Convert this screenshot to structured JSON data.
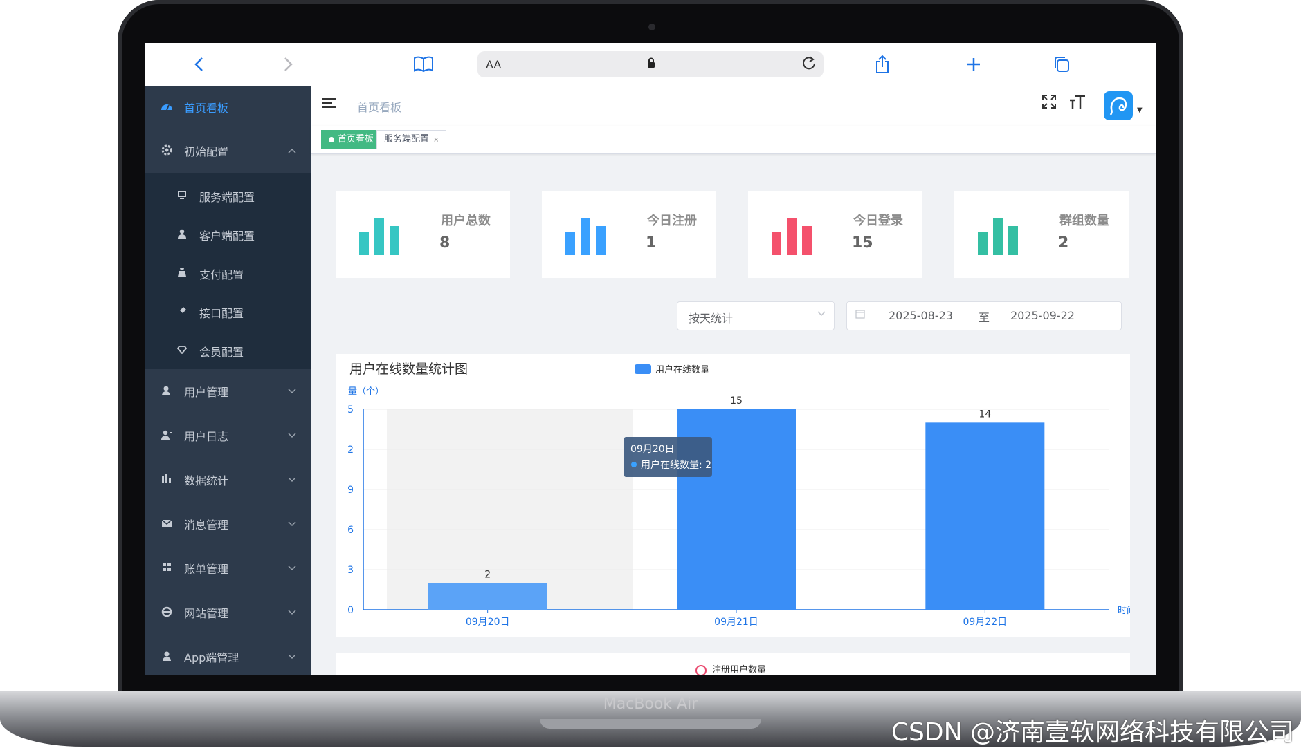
{
  "device": {
    "label": "MacBook Air"
  },
  "watermark": "CSDN @济南壹软网络科技有限公司",
  "browser": {
    "url_text_size": "AA",
    "icons": [
      "back-icon",
      "forward-icon",
      "bookmarks-icon",
      "lock-icon",
      "reload-icon",
      "share-icon",
      "new-tab-icon",
      "tabs-icon"
    ]
  },
  "sidebar": {
    "items": [
      {
        "label": "首页看板",
        "icon": "dashboard-icon",
        "active": true
      },
      {
        "label": "初始配置",
        "icon": "config-icon",
        "expanded": true,
        "children": [
          {
            "label": "服务端配置",
            "icon": "server-icon"
          },
          {
            "label": "客户端配置",
            "icon": "user-icon"
          },
          {
            "label": "支付配置",
            "icon": "payment-icon"
          },
          {
            "label": "接口配置",
            "icon": "api-icon"
          },
          {
            "label": "会员配置",
            "icon": "diamond-icon"
          }
        ]
      },
      {
        "label": "用户管理",
        "icon": "user-manage-icon"
      },
      {
        "label": "用户日志",
        "icon": "user-log-icon"
      },
      {
        "label": "数据统计",
        "icon": "stats-icon"
      },
      {
        "label": "消息管理",
        "icon": "mail-icon"
      },
      {
        "label": "账单管理",
        "icon": "bill-icon"
      },
      {
        "label": "网站管理",
        "icon": "web-icon"
      },
      {
        "label": "App端管理",
        "icon": "app-icon"
      }
    ]
  },
  "header": {
    "breadcrumb": "首页看板"
  },
  "tags": [
    {
      "label": "首页看板",
      "active": true
    },
    {
      "label": "服务端配置",
      "active": false,
      "close": "×"
    }
  ],
  "stats": [
    {
      "title": "用户总数",
      "value": "8",
      "color": "#36c6c3"
    },
    {
      "title": "今日注册",
      "value": "1",
      "color": "#3aa1ff"
    },
    {
      "title": "今日登录",
      "value": "15",
      "color": "#f4516c"
    },
    {
      "title": "群组数量",
      "value": "2",
      "color": "#34bfa3"
    }
  ],
  "filters": {
    "mode": "按天统计",
    "start_date": "2025-08-23",
    "separator": "至",
    "end_date": "2025-09-22"
  },
  "chart_data": {
    "type": "bar",
    "title": "用户在线数量统计图",
    "ylabel": "量（个）",
    "xlabel": "时间",
    "y_tick_labels": [
      "0",
      "3",
      "6",
      "9",
      "2",
      "5"
    ],
    "ylim": [
      0,
      15
    ],
    "categories": [
      "09月20日",
      "09月21日",
      "09月22日"
    ],
    "series": [
      {
        "name": "用户在线数量",
        "values": [
          2,
          15,
          14
        ],
        "color": "#3a8ef6"
      }
    ],
    "legend": "top-center",
    "grid": true,
    "tooltip": {
      "title": "09月20日",
      "series": "用户在线数量",
      "value": "2"
    }
  },
  "second_chart": {
    "legend": "注册用户数量"
  }
}
